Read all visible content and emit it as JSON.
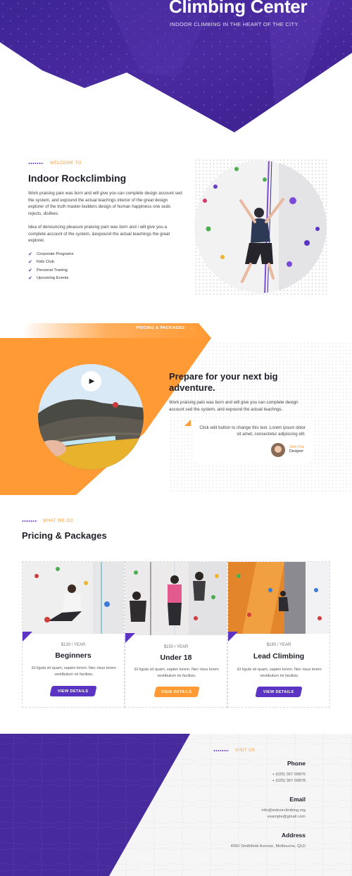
{
  "hero": {
    "title": "Climbing Center",
    "subtitle": "INDOOR CLIMBING IN THE HEART OF THE CITY."
  },
  "welcome": {
    "eyebrow": "WELCOME TO",
    "title": "Indoor Rockclimbing",
    "para1": "Work praising pain was born and will give you can complete design account sed the system, and expound the actual teachngs interior of the great design explorer of the truth master-builders design of human happiness one seds rejects, dislikes.",
    "para2": "Idea of denouncing pleasure praising pain was born and i will give you a complete account of the system, &expound the actual teachings the great explorer.",
    "features": [
      "Corporate Programs",
      "Kids Club",
      "Personal Traning",
      "Upcoming Events"
    ]
  },
  "adventure": {
    "tab_label": "PRICING & PACKAGES",
    "tab_arrow": "→",
    "title_line1": "Prepare for your next big",
    "title_line2": "adventure.",
    "para": "Work praising pain was born and will give you can complete design account sed the system, and expound the actual teachngs.",
    "quote": "Click edit button to change this text. Lorem ipsum dolor sit amet, consectetur adipiscing elit.",
    "author_name": "John Doe",
    "author_role": "Designer"
  },
  "pricing": {
    "eyebrow": "WHAT WE DO",
    "title": "Pricing & Packages",
    "cards": [
      {
        "price": "$130 / YEAR",
        "name": "Beginners",
        "desc": "Et ligula sit quam, sapien lorem. Nec risus lorem vestibulum mi facilisis.",
        "button": "VIEW DETAILS",
        "button_color": "#5b34c4"
      },
      {
        "price": "$150 / YEAR",
        "name": "Under 18",
        "desc": "Et ligula sit quam, sapien lorem. Nec risus lorem vestibulum mi facilisis.",
        "button": "VIEW DETAILS",
        "button_color": "#ff9a34"
      },
      {
        "price": "$180 / YEAR",
        "name": "Lead Climbing",
        "desc": "Et ligula sit quam, sapien lorem. Nec risus lorem vestibulum mi facilisis.",
        "button": "VIEW DETAILS",
        "button_color": "#5b34c4"
      }
    ]
  },
  "contact": {
    "eyebrow": "VISIT US",
    "phone_label": "Phone",
    "phone1": "+ (025) 367 09876",
    "phone2": "+ (025) 367 09878",
    "email_label": "Email",
    "email1": "info@indoorclimbing.org",
    "email2": "example@gmail.com",
    "address_label": "Address",
    "address": "4050 Smithfield Avenue, Melbourne, QLD"
  },
  "colors": {
    "purple": "#4a2a9c",
    "accent_purple": "#5b34c4",
    "orange": "#ff9a34"
  },
  "icons": {
    "play": "play-icon",
    "check": "check-icon",
    "arrow": "arrow-right-icon"
  }
}
